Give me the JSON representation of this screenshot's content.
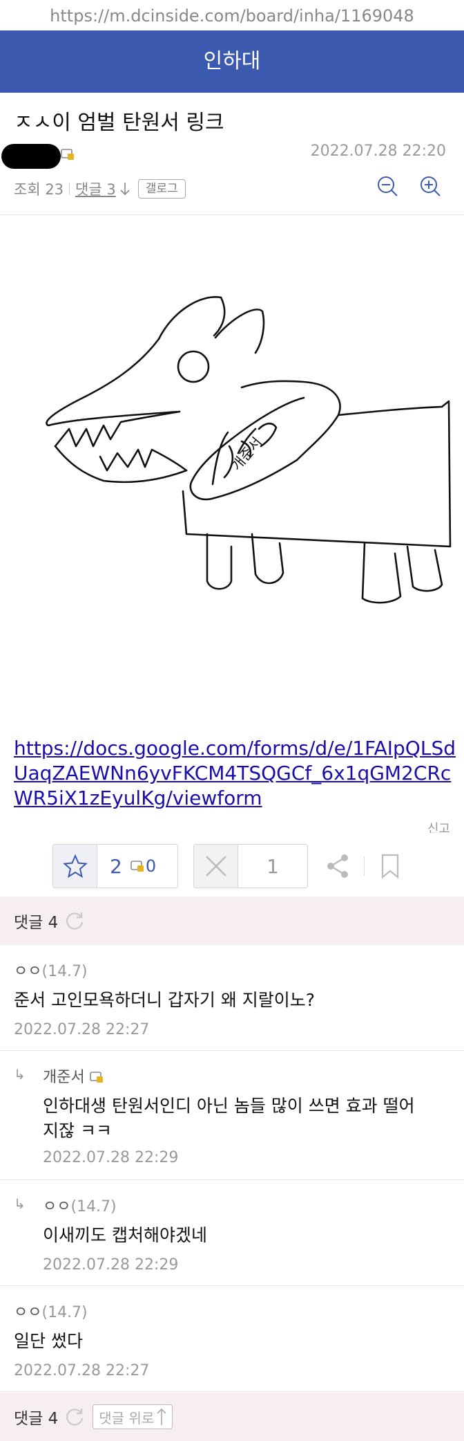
{
  "browser": {
    "url": "https://m.dcinside.com/board/inha/1169048"
  },
  "header": {
    "title": "인하대"
  },
  "post": {
    "title": "ㅈㅅ이 엄벌 탄원서 링크",
    "date": "2022.07.28 22:20",
    "views": "조회 23",
    "comments_link": "댓글 3",
    "gallog": "갤로그",
    "drawing_text": "개준서",
    "link": "https://docs.google.com/forms/d/e/1FAIpQLSdUaqZAEWNn6yvFKCM4TSQGCf_6x1qGM2CRcWR5iX1zEyulKg/viewform",
    "report": "신고"
  },
  "actions": {
    "recommend_count": "2",
    "fixed_recommend_count": "0",
    "nonrecommend_count": "1"
  },
  "comment_section": {
    "label": "댓글 4",
    "go_top": "댓글 위로"
  },
  "comments": [
    {
      "nick": "ㅇㅇ",
      "ip": "(14.7)",
      "text": "준서 고인모욕하더니 갑자기 왜 지랄이노?",
      "date": "2022.07.28 22:27"
    },
    {
      "nick": "개준서",
      "text": "인하대생 탄원서인디 아닌 놈들 많이 쓰면 효과 떨어지잖 ㅋㅋ",
      "date": "2022.07.28 22:29",
      "reply": true
    },
    {
      "nick": "ㅇㅇ",
      "ip": "(14.7)",
      "text": "이새끼도 캡처해야겠네",
      "date": "2022.07.28 22:29",
      "reply": true
    },
    {
      "nick": "ㅇㅇ",
      "ip": "(14.7)",
      "text": "일단 썼다",
      "date": "2022.07.28 22:27"
    }
  ],
  "colors": {
    "header_bg": "#3b59af",
    "accent": "#3b59af",
    "comment_head_bg": "#f6eef2",
    "link": "#1a0dab"
  }
}
